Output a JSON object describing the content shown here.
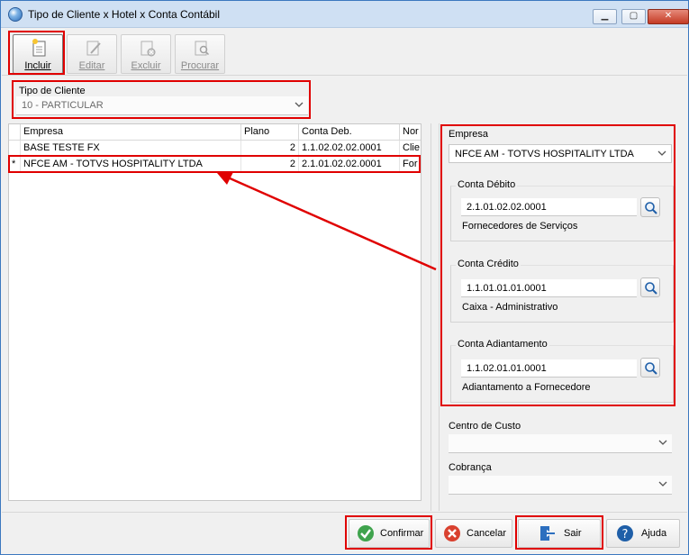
{
  "window": {
    "title": "Tipo de Cliente x Hotel x Conta Contábil",
    "minimize": "▁",
    "maximize": "▢",
    "close": "✕"
  },
  "toolbar": {
    "incluir": "Incluir",
    "editar": "Editar",
    "excluir": "Excluir",
    "procurar": "Procurar"
  },
  "tipo_cliente": {
    "label": "Tipo de Cliente",
    "value": "10 - PARTICULAR"
  },
  "grid": {
    "columns": [
      "Empresa",
      "Plano",
      "Conta Deb.",
      "Nor"
    ],
    "rows": [
      {
        "marker": "",
        "empresa": "BASE TESTE FX",
        "plano": "2",
        "conta": "1.1.02.02.02.0001",
        "nor": "Clie"
      },
      {
        "marker": "*",
        "empresa": "NFCE AM - TOTVS HOSPITALITY LTDA",
        "plano": "2",
        "conta": "2.1.01.02.02.0001",
        "nor": "For"
      }
    ]
  },
  "right": {
    "empresa_label": "Empresa",
    "empresa_value": "NFCE AM - TOTVS HOSPITALITY LTDA",
    "debito": {
      "label": "Conta Débito",
      "value": "2.1.01.02.02.0001",
      "desc": "Fornecedores de Serviços"
    },
    "credito": {
      "label": "Conta Crédito",
      "value": "1.1.01.01.01.0001",
      "desc": "Caixa - Administrativo"
    },
    "adiantamento": {
      "label": "Conta Adiantamento",
      "value": "1.1.02.01.01.0001",
      "desc": "Adiantamento a Fornecedore"
    },
    "centro_custo_label": "Centro de Custo",
    "centro_custo_value": "",
    "cobranca_label": "Cobrança",
    "cobranca_value": ""
  },
  "footer": {
    "confirmar": "Confirmar",
    "cancelar": "Cancelar",
    "sair": "Sair",
    "ajuda": "Ajuda"
  },
  "colors": {
    "highlight": "#e00000",
    "titlebar": "#cfe0f3"
  }
}
